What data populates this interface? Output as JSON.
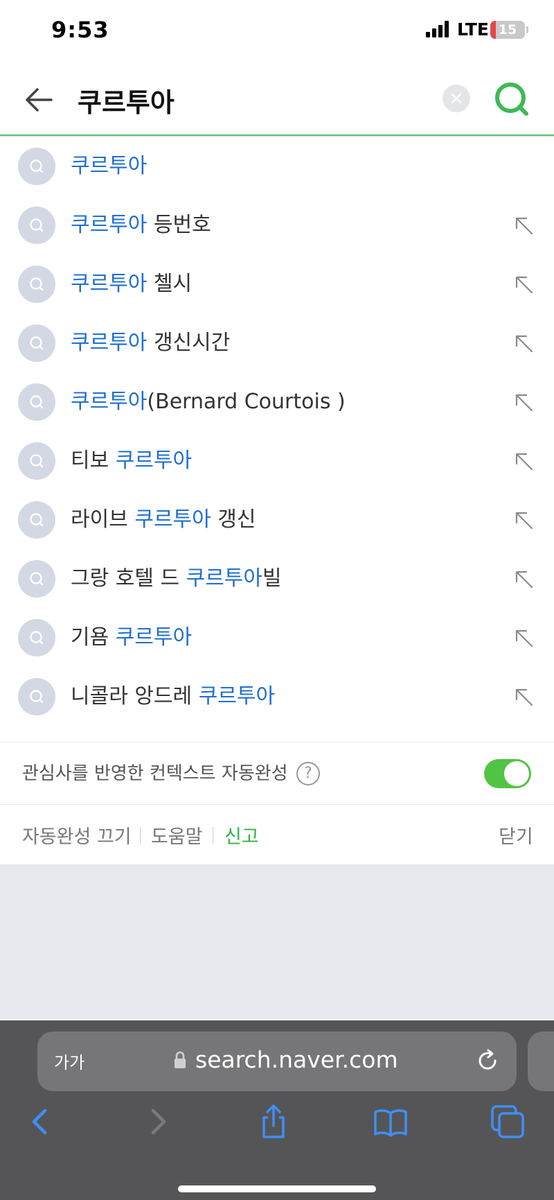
{
  "status_bar": {
    "time": "9:53",
    "network": "LTE",
    "battery": "15",
    "battery_level": 0.15
  },
  "search": {
    "query": "쿠르투아",
    "back_icon": "arrow-left-icon",
    "clear_icon": "close-icon",
    "submit_icon": "search-icon",
    "accent_color": "#56c46a"
  },
  "suggestions": [
    {
      "parts": [
        {
          "t": "쿠르투아",
          "hl": true
        }
      ],
      "show_arrow": false
    },
    {
      "parts": [
        {
          "t": "쿠르투아",
          "hl": true
        },
        {
          "t": " 등번호",
          "hl": false
        }
      ],
      "show_arrow": true
    },
    {
      "parts": [
        {
          "t": "쿠르투아",
          "hl": true
        },
        {
          "t": " 첼시",
          "hl": false
        }
      ],
      "show_arrow": true
    },
    {
      "parts": [
        {
          "t": "쿠르투아",
          "hl": true
        },
        {
          "t": " 갱신시간",
          "hl": false
        }
      ],
      "show_arrow": true
    },
    {
      "parts": [
        {
          "t": "쿠르투아",
          "hl": true
        },
        {
          "t": "(Bernard Courtois )",
          "hl": false
        }
      ],
      "show_arrow": true
    },
    {
      "parts": [
        {
          "t": "티보 ",
          "hl": false
        },
        {
          "t": "쿠르투아",
          "hl": true
        }
      ],
      "show_arrow": true
    },
    {
      "parts": [
        {
          "t": "라이브 ",
          "hl": false
        },
        {
          "t": "쿠르투아",
          "hl": true
        },
        {
          "t": " 갱신",
          "hl": false
        }
      ],
      "show_arrow": true
    },
    {
      "parts": [
        {
          "t": "그랑 호텔 드 ",
          "hl": false
        },
        {
          "t": "쿠르투아",
          "hl": true
        },
        {
          "t": "빌",
          "hl": false
        }
      ],
      "show_arrow": true
    },
    {
      "parts": [
        {
          "t": "기욤 ",
          "hl": false
        },
        {
          "t": "쿠르투아",
          "hl": true
        }
      ],
      "show_arrow": true
    },
    {
      "parts": [
        {
          "t": "니콜라 앙드레 ",
          "hl": false
        },
        {
          "t": "쿠르투아",
          "hl": true
        }
      ],
      "show_arrow": true
    }
  ],
  "context_autocomplete": {
    "label": "관심사를 반영한 컨텍스트 자동완성",
    "help": "?",
    "enabled": true,
    "toggle_color": "#52c444"
  },
  "footer": {
    "turn_off": "자동완성 끄기",
    "help": "도움말",
    "report": "신고",
    "close": "닫기"
  },
  "browser": {
    "text_size": "가가",
    "url": "search.naver.com",
    "icons": [
      "back-icon",
      "forward-icon",
      "share-icon",
      "bookmarks-icon",
      "tabs-icon"
    ]
  }
}
